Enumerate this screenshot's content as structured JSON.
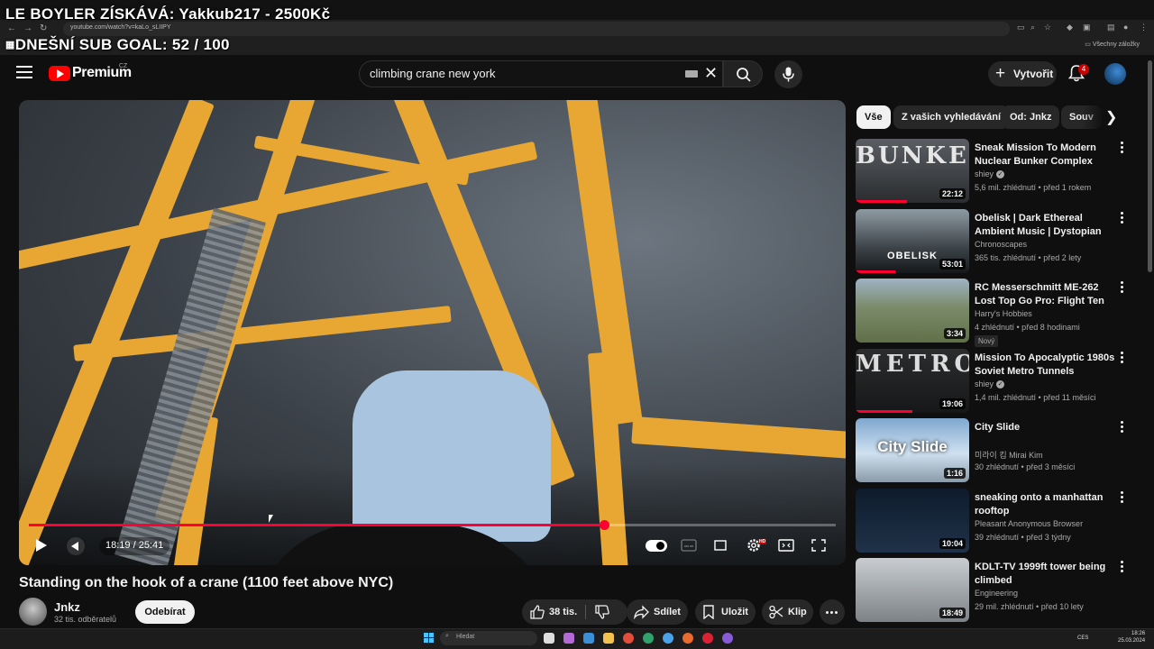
{
  "stream_overlay": {
    "line1": "LE BOYLER ZÍSKÁVÁ: Yakkub217 - 2500Kč",
    "line2": "DNEŠNÍ SUB GOAL: 52 / 100"
  },
  "browser": {
    "url": "youtube.com/watch?v=kaLo_sLIIPY",
    "bookmarks_all": "Všechny záložky"
  },
  "header": {
    "logo_text": "Premium",
    "country_code": "CZ",
    "search_value": "climbing crane new york",
    "create_label": "Vytvořit",
    "notification_count": "4"
  },
  "player": {
    "time_display": "18:19 / 25:41",
    "progress_fraction": 0.7125,
    "hd_badge": "HD"
  },
  "video": {
    "title": "Standing on the hook of a crane (1100 feet above NYC)",
    "channel_name": "Jnkz",
    "channel_subs": "32 tis. odběratelů",
    "subscribe_label": "Odebírat",
    "like_count": "38 tis.",
    "share_label": "Sdílet",
    "save_label": "Uložit",
    "clip_label": "Klip"
  },
  "chips": [
    "Vše",
    "Z vašich vyhledávání",
    "Od: Jnkz",
    "Souv"
  ],
  "recommendations": [
    {
      "title": "Sneak Mission To Modern Nuclear Bunker Complex",
      "channel": "shiey",
      "verified": true,
      "views": "5,6 mil. zhlédnutí",
      "age": "před 1 rokem",
      "duration": "22:12",
      "thumb_text": "BUNKER",
      "watched_fraction": 0.45,
      "badge": ""
    },
    {
      "title": "Obelisk | Dark Ethereal Ambient Music | Dystopian Dark Ambie…",
      "channel": "Chronoscapes",
      "verified": false,
      "views": "365 tis. zhlédnutí",
      "age": "před 2 lety",
      "duration": "53:01",
      "thumb_text": "OBELISK",
      "watched_fraction": 0.35,
      "badge": ""
    },
    {
      "title": "RC Messerschmitt ME-262 Lost Top Go Pro: Flight Ten",
      "channel": "Harry's Hobbies",
      "verified": false,
      "views": "4 zhlédnutí",
      "age": "před 8 hodinami",
      "duration": "3:34",
      "thumb_text": "",
      "watched_fraction": 0,
      "badge": "Nový"
    },
    {
      "title": "Mission To Apocalyptic 1980s Soviet Metro Tunnels",
      "channel": "shiey",
      "verified": true,
      "views": "1,4 mil. zhlédnutí",
      "age": "před 11 měsíci",
      "duration": "19:06",
      "thumb_text": "METRO",
      "watched_fraction": 0.5,
      "badge": ""
    },
    {
      "title": "City Slide",
      "channel": "미라이 킴 Mirai Kim",
      "verified": false,
      "views": "30 zhlédnutí",
      "age": "před 3 měsíci",
      "duration": "1:16",
      "thumb_text": "City Slide",
      "watched_fraction": 0,
      "badge": ""
    },
    {
      "title": "sneaking onto a manhattan rooftop",
      "channel": "Pleasant Anonymous Browser",
      "verified": false,
      "views": "39 zhlédnutí",
      "age": "před 3 týdny",
      "duration": "10:04",
      "thumb_text": "",
      "watched_fraction": 0,
      "badge": ""
    },
    {
      "title": "KDLT-TV 1999ft tower being climbed",
      "channel": "Engineering",
      "verified": false,
      "views": "29 mil. zhlédnutí",
      "age": "před 10 lety",
      "duration": "18:49",
      "thumb_text": "",
      "watched_fraction": 0,
      "badge": ""
    }
  ],
  "taskbar": {
    "search_placeholder": "Hledat",
    "lang": "CES",
    "time": "18:26",
    "date": "25.03.2024"
  }
}
